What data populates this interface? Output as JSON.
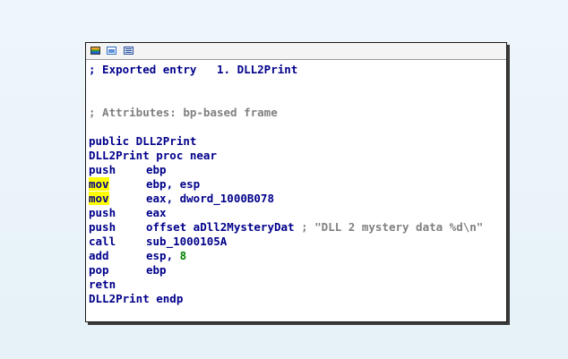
{
  "node": {
    "header_icons": [
      "graph-colors-icon",
      "picture-icon",
      "text-view-icon"
    ],
    "exported_entry": "; Exported entry   1. DLL2Print",
    "attributes_comment": "; Attributes: bp-based frame",
    "public_decl": "public DLL2Print",
    "proc_decl": "DLL2Print proc near",
    "instructions": [
      {
        "mnemonic": "push",
        "operand": "ebp",
        "highlight": false
      },
      {
        "mnemonic": "mov",
        "operand": "ebp, esp",
        "highlight": true
      },
      {
        "mnemonic": "mov",
        "operand": "eax, dword_1000B078",
        "highlight": true
      },
      {
        "mnemonic": "push",
        "operand": "eax",
        "highlight": false
      },
      {
        "mnemonic": "push",
        "operand": "offset aDll2MysteryDat",
        "comment": "; \"DLL 2 mystery data %d\\n\"",
        "highlight": false
      },
      {
        "mnemonic": "call",
        "operand": "sub_1000105A",
        "highlight": false
      },
      {
        "mnemonic": "add",
        "operand": "esp, ",
        "immediate": "8",
        "highlight": false
      },
      {
        "mnemonic": "pop",
        "operand": "ebp",
        "highlight": false
      },
      {
        "mnemonic": "retn",
        "operand": "",
        "highlight": false
      }
    ],
    "endp": "DLL2Print endp"
  },
  "colors": {
    "code": "#00008b",
    "comment": "#808080",
    "immediate": "#008000",
    "highlight": "#ffff00"
  }
}
